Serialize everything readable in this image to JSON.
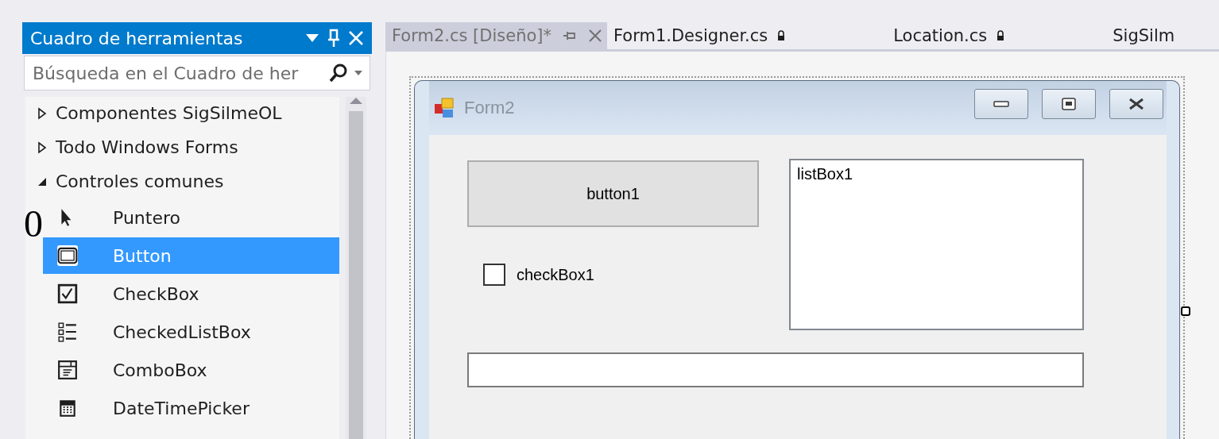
{
  "toolbox": {
    "title": "Cuadro de herramientas",
    "search": {
      "placeholder": "Búsqueda en el Cuadro de her"
    },
    "groups": [
      {
        "label": "Componentes SigSilmeOL",
        "expanded": false
      },
      {
        "label": "Todo Windows Forms",
        "expanded": false
      },
      {
        "label": "Controles comunes",
        "expanded": true,
        "children": [
          {
            "label": "Puntero",
            "kind": "pointer",
            "selected": false
          },
          {
            "label": "Button",
            "kind": "button",
            "selected": true
          },
          {
            "label": "CheckBox",
            "kind": "checkbox",
            "selected": false
          },
          {
            "label": "CheckedListBox",
            "kind": "checkedlist",
            "selected": false
          },
          {
            "label": "ComboBox",
            "kind": "combobox",
            "selected": false
          },
          {
            "label": "DateTimePicker",
            "kind": "datetime",
            "selected": false
          }
        ]
      }
    ]
  },
  "marker": "0",
  "tabs": [
    {
      "label": "Form2.cs [Diseño]*",
      "selected": true,
      "kind": "closable"
    },
    {
      "label": "Form1.Designer.cs",
      "selected": false,
      "kind": "locked"
    },
    {
      "label": "Location.cs",
      "selected": false,
      "kind": "locked"
    },
    {
      "label": "SigSilm",
      "selected": false,
      "kind": "plain"
    }
  ],
  "form": {
    "title": "Form2",
    "controls": [
      {
        "kind": "button",
        "label": "button1"
      },
      {
        "kind": "listbox",
        "items": [
          "listBox1"
        ]
      },
      {
        "kind": "checkbox",
        "label": "checkBox1",
        "checked": false
      },
      {
        "kind": "textbox"
      }
    ]
  }
}
